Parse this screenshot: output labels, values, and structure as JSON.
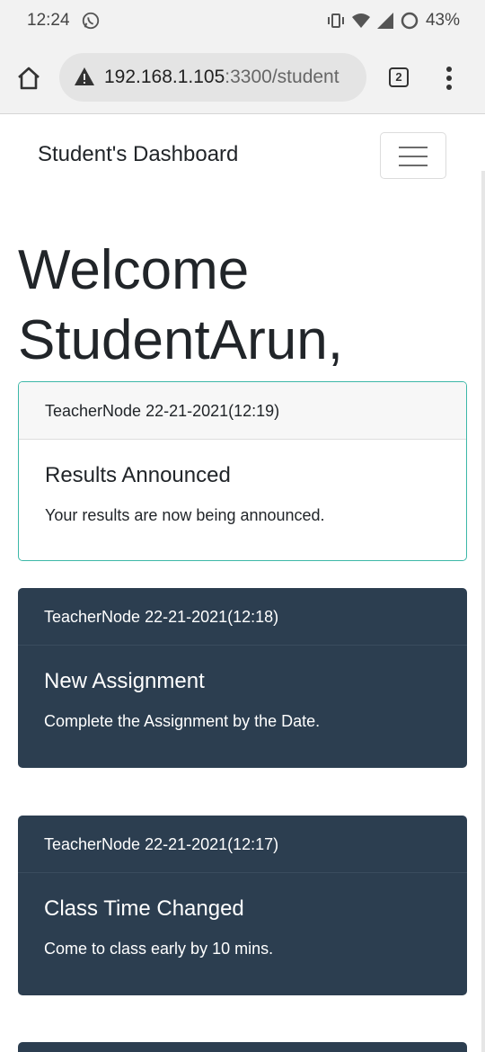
{
  "status_bar": {
    "time": "12:24",
    "battery": "43%",
    "icons": [
      "whatsapp-icon",
      "vibrate-icon",
      "wifi-icon",
      "signal-icon",
      "battery-saver-icon"
    ]
  },
  "browser": {
    "url_host": "192.168.1.105",
    "url_path": ":3300/student",
    "tab_count": "2",
    "icons": [
      "home-icon",
      "not-secure-warning-icon",
      "more-vert-icon"
    ]
  },
  "navbar": {
    "brand": "Student's Dashboard",
    "toggler_icon": "hamburger-icon"
  },
  "page": {
    "welcome_line1": "Welcome",
    "welcome_line2": "StudentArun,"
  },
  "notices": [
    {
      "header": "TeacherNode 22-21-2021(12:19)",
      "title": "Results Announced",
      "text": "Your results are now being announced."
    },
    {
      "header": "TeacherNode 22-21-2021(12:18)",
      "title": "New Assignment",
      "text": "Complete the Assignment by the Date."
    },
    {
      "header": "TeacherNode 22-21-2021(12:17)",
      "title": "Class Time Changed",
      "text": "Come to class early by 10 mins."
    }
  ],
  "colors": {
    "dark_card": "#2c3e50",
    "light_card_border": "#3db8a8"
  }
}
